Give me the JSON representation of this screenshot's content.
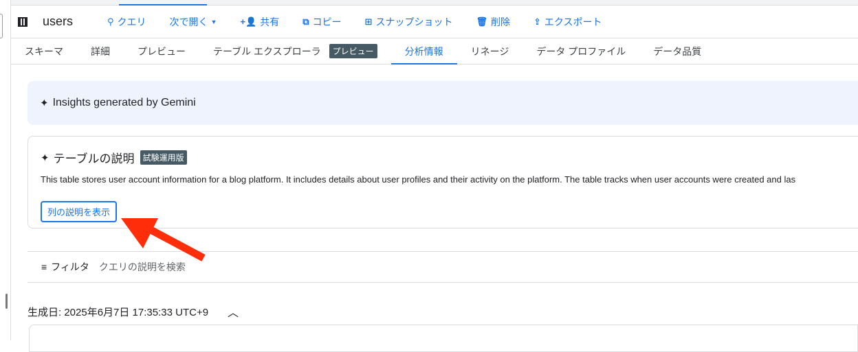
{
  "toolbar": {
    "title": "users",
    "query": "クエリ",
    "open_in": "次で開く",
    "share": "共有",
    "copy": "コピー",
    "snapshot": "スナップショット",
    "delete": "削除",
    "export": "エクスポート"
  },
  "tabs": [
    "スキーマ",
    "詳細",
    "プレビュー",
    "テーブル エクスプローラ",
    "分析情報",
    "リネージ",
    "データ プロファイル",
    "データ品質"
  ],
  "tab_badge": "プレビュー",
  "banner": {
    "title": "Insights generated by Gemini"
  },
  "card": {
    "title": "テーブルの説明",
    "badge": "試験運用版",
    "description": "This table stores user account information for a blog platform. It includes details about user profiles and their activity on the platform. The table tracks when user accounts were created and las",
    "button": "列の説明を表示"
  },
  "filter": {
    "label": "フィルタ",
    "placeholder": "クエリの説明を検索"
  },
  "generated": "生成日: 2025年6月7日 17:35:33 UTC+9",
  "colors": {
    "accent": "#1a73e8",
    "arrow": "#ff2d0a"
  }
}
